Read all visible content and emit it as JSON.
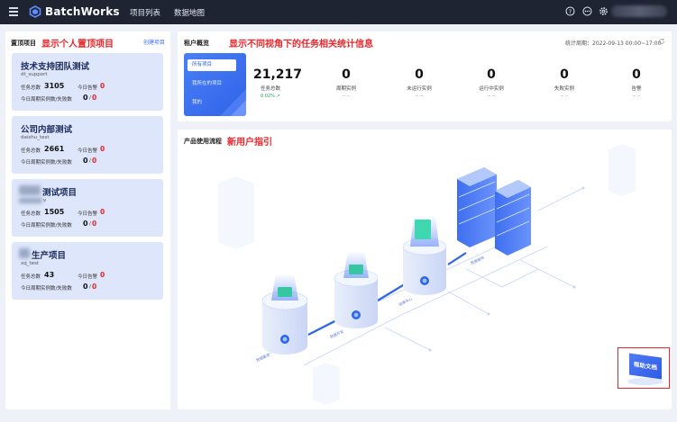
{
  "topbar": {
    "brand": "BatchWorks",
    "nav": [
      "项目列表",
      "数据地图"
    ],
    "icons": [
      "menu-icon",
      "logo-icon",
      "help-icon",
      "message-icon",
      "settings-icon"
    ]
  },
  "pinned": {
    "title": "置顶项目",
    "annotation": "显示个人置顶项目",
    "create_label": "创建项目",
    "task_total_label": "任务总数",
    "alarm_label": "今日告警",
    "period_label": "今日周期实例数/失败数",
    "projects": [
      {
        "name": "技术支持团队测试",
        "code": "dt_support",
        "tasks": "3105",
        "alarms": "0",
        "done": "0",
        "failed": "0"
      },
      {
        "name": "公司内部测试",
        "code": "daishu_test",
        "tasks": "2661",
        "alarms": "0",
        "done": "0",
        "failed": "0"
      },
      {
        "name": "测试项目",
        "code": "v",
        "tasks": "1505",
        "alarms": "0",
        "done": "0",
        "failed": "0"
      },
      {
        "name": "生产项目",
        "code": "xq_test",
        "tasks": "43",
        "alarms": "0",
        "done": "0",
        "failed": "0"
      }
    ]
  },
  "overview": {
    "title": "租户概览",
    "annotation": "显示不同视角下的任务相关统计信息",
    "time_label": "统计周期：2022-09-13 00:00~17:00",
    "tabs": [
      "所有项目",
      "我所在的项目",
      "我的"
    ],
    "stats": [
      {
        "value": "21,217",
        "label": "任务总数",
        "trend": "0.02% ↗"
      },
      {
        "value": "0",
        "label": "周期实例",
        "sub": "-- --"
      },
      {
        "value": "0",
        "label": "未运行实例",
        "sub": "-- --"
      },
      {
        "value": "0",
        "label": "运行中实例",
        "sub": "-- --"
      },
      {
        "value": "0",
        "label": "失败实例",
        "sub": "-- --"
      },
      {
        "value": "0",
        "label": "告警",
        "sub": "-- --"
      }
    ]
  },
  "flow": {
    "title": "产品使用流程",
    "annotation": "新用户指引",
    "help_label": "帮助文档"
  },
  "colors": {
    "topbar": "#1f2433",
    "accent": "#2f62e8",
    "card": "#dde6fb",
    "annotation": "#e8262b"
  }
}
